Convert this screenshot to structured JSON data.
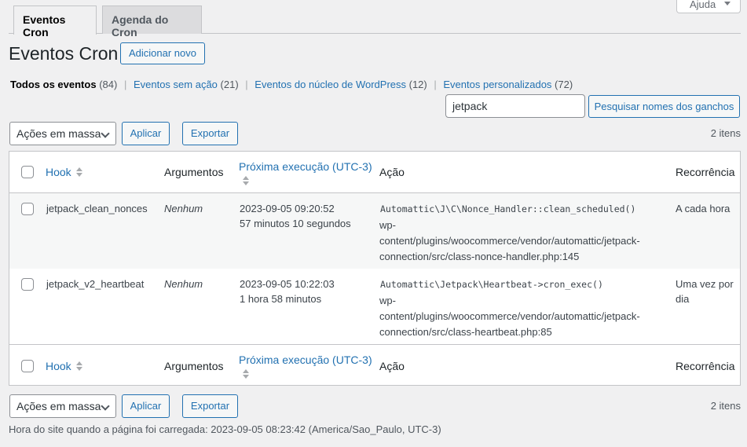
{
  "help_tab": {
    "label": "Ajuda"
  },
  "tabs": [
    {
      "label": "Eventos Cron",
      "active": true
    },
    {
      "label": "Agenda do Cron",
      "active": false
    }
  ],
  "page": {
    "title": "Eventos Cron",
    "add_new_label": "Adicionar novo"
  },
  "filters": [
    {
      "label": "Todos os eventos",
      "count": "(84)",
      "current": true
    },
    {
      "label": "Eventos sem ação",
      "count": "(21)",
      "current": false
    },
    {
      "label": "Eventos do núcleo de WordPress",
      "count": "(12)",
      "current": false
    },
    {
      "label": "Eventos personalizados",
      "count": "(72)",
      "current": false
    }
  ],
  "search": {
    "value": "jetpack",
    "button_label": "Pesquisar nomes dos ganchos"
  },
  "bulk": {
    "select_label": "Ações em massa",
    "apply_label": "Aplicar",
    "export_label": "Exportar",
    "items_count": "2 itens"
  },
  "table": {
    "columns": {
      "hook": "Hook",
      "arguments": "Argumentos",
      "next_run": "Próxima execução (UTC-3)",
      "action": "Ação",
      "recurrence": "Recorrência"
    },
    "rows": [
      {
        "hook": "jetpack_clean_nonces",
        "arguments": "Nenhum",
        "next_run_date": "2023-09-05 09:20:52",
        "next_run_relative": "57 minutos 10 segundos",
        "action_callback": "Automattic\\J\\C\\Nonce_Handler::clean_scheduled()",
        "action_file_1": "wp-",
        "action_file_2": "content/plugins/woocommerce/vendor/automattic/jetpack-",
        "action_file_3": "connection/src/class-nonce-handler.php:145",
        "recurrence_1": "A cada hora",
        "recurrence_2": ""
      },
      {
        "hook": "jetpack_v2_heartbeat",
        "arguments": "Nenhum",
        "next_run_date": "2023-09-05 10:22:03",
        "next_run_relative": "1 hora 58 minutos",
        "action_callback": "Automattic\\Jetpack\\Heartbeat->cron_exec()",
        "action_file_1": "wp-",
        "action_file_2": "content/plugins/woocommerce/vendor/automattic/jetpack-",
        "action_file_3": "connection/src/class-heartbeat.php:85",
        "recurrence_1": "Uma vez por",
        "recurrence_2": "dia"
      }
    ]
  },
  "footer": {
    "note": "Hora do site quando a página foi carregada: 2023-09-05 08:23:42 (America/Sao_Paulo, UTC-3)"
  },
  "colors": {
    "accent": "#2271b1",
    "background": "#f0f0f1",
    "text": "#3c434a"
  }
}
